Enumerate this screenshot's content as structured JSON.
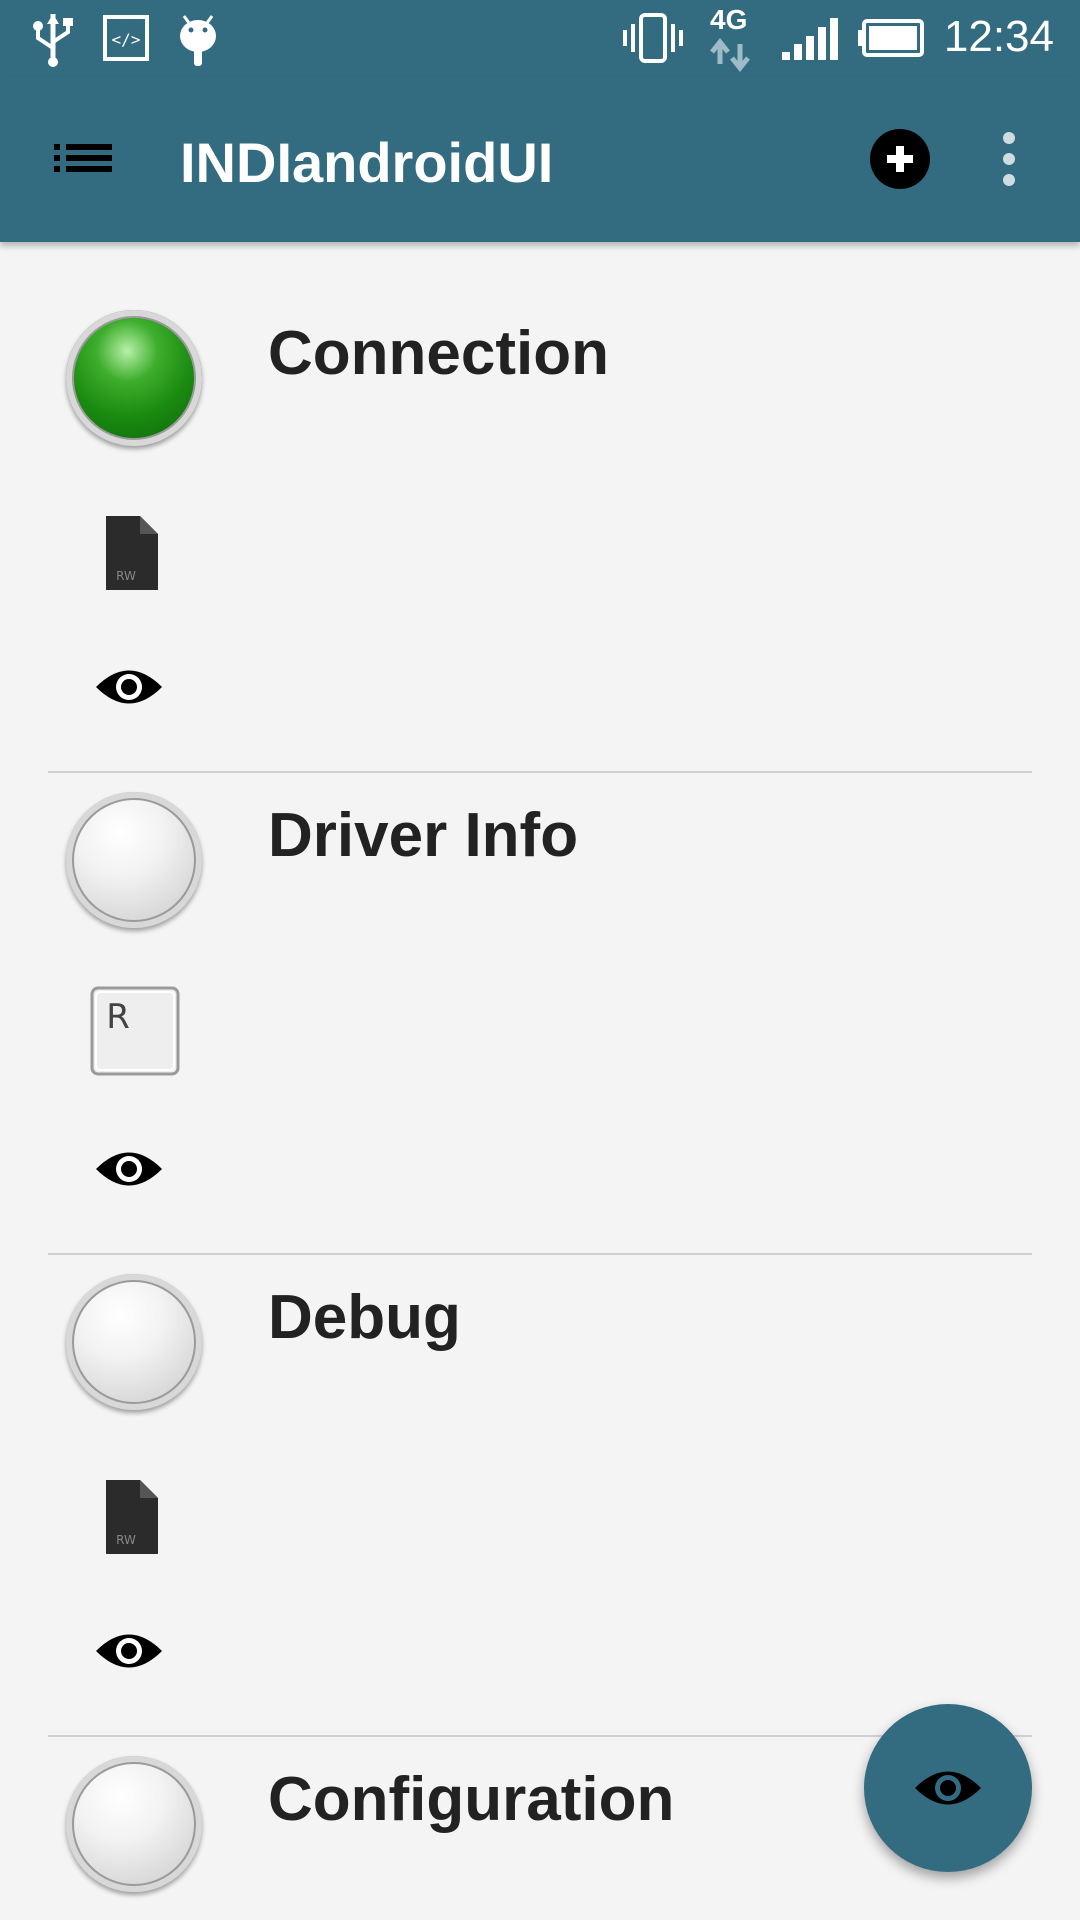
{
  "status_bar": {
    "time": "12:34",
    "network_label": "4G",
    "icons": [
      "usb-icon",
      "code-icon",
      "android-icon",
      "vibrate-icon",
      "network-4g-icon",
      "signal-icon",
      "battery-icon"
    ]
  },
  "toolbar": {
    "title": "INDIandroidUI",
    "icons": [
      "list-icon",
      "add-circle-icon",
      "more-vert-icon"
    ]
  },
  "groups": [
    {
      "label": "Connection",
      "state": "ok",
      "state_color": "#1f9a14",
      "permission": "RW"
    },
    {
      "label": "Driver Info",
      "state": "idle",
      "state_color": "#dcdcdc",
      "permission": "R"
    },
    {
      "label": "Debug",
      "state": "idle",
      "state_color": "#dcdcdc",
      "permission": "RW"
    },
    {
      "label": "Configuration",
      "state": "idle",
      "state_color": "#dcdcdc",
      "permission": ""
    }
  ],
  "colors": {
    "primary": "#336c80",
    "background": "#f4f4f4",
    "text": "#222222"
  },
  "fab": {
    "icon": "eye-icon"
  }
}
